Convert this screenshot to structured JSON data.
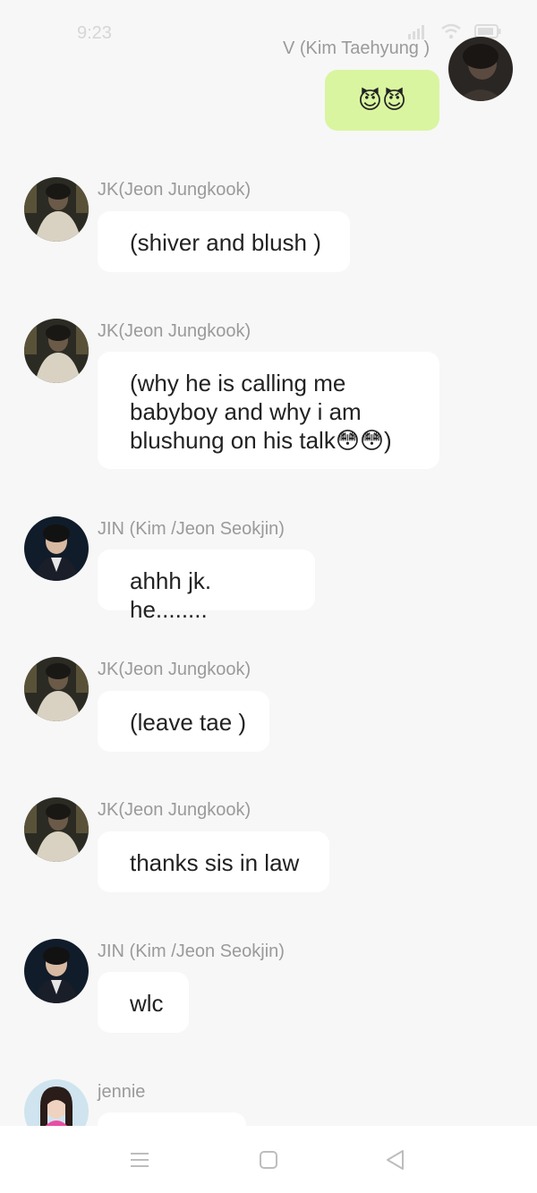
{
  "status_bar": {
    "time": "9:23"
  },
  "colors": {
    "background": "#f7f7f7",
    "my_bubble": "#d9f5a0",
    "other_bubble": "#ffffff",
    "sender_name": "#9a9a9a"
  },
  "messages": [
    {
      "sender": "V (Kim Taehyung )",
      "text": "😈😈",
      "mine": true,
      "avatar": "taehyung-avatar"
    },
    {
      "sender": "JK(Jeon Jungkook)",
      "text": "(shiver and blush )",
      "mine": false,
      "avatar": "jungkook-avatar"
    },
    {
      "sender": "JK(Jeon Jungkook)",
      "text": "(why he is calling me\nbabyboy and why i am\nblushung on his talk😳😳)",
      "mine": false,
      "avatar": "jungkook-avatar"
    },
    {
      "sender": "JIN (Kim /Jeon Seokjin)",
      "text": "ahhh jk. he........",
      "mine": false,
      "avatar": "jin-avatar"
    },
    {
      "sender": "JK(Jeon Jungkook)",
      "text": "(leave tae )",
      "mine": false,
      "avatar": "jungkook-avatar"
    },
    {
      "sender": "JK(Jeon Jungkook)",
      "text": "thanks sis in law",
      "mine": false,
      "avatar": "jungkook-avatar"
    },
    {
      "sender": "JIN (Kim /Jeon Seokjin)",
      "text": "wlc",
      "mine": false,
      "avatar": "jin-avatar"
    },
    {
      "sender": "jennie",
      "text": "",
      "mine": false,
      "avatar": "jennie-avatar"
    }
  ],
  "nav_bar": {
    "icons": [
      "menu-icon",
      "home-square-icon",
      "back-triangle-icon"
    ]
  }
}
